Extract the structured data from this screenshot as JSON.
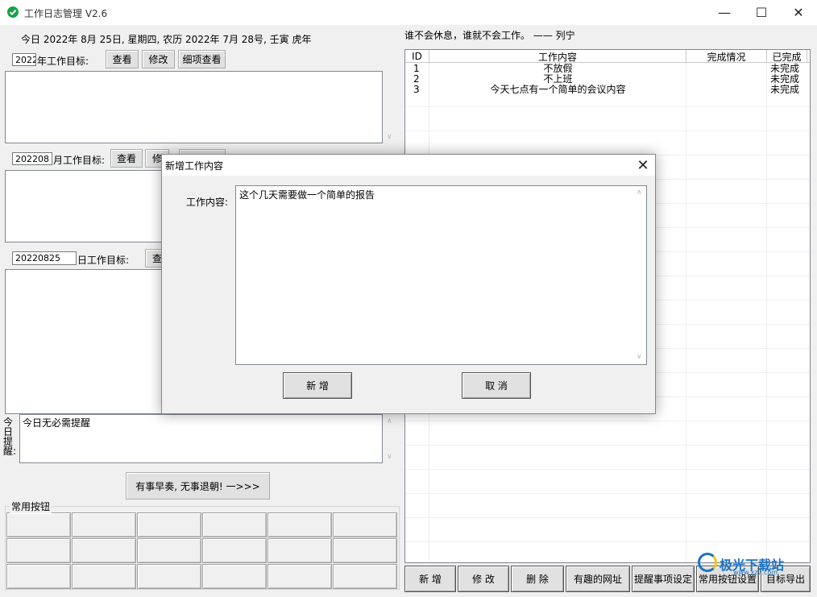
{
  "window": {
    "title": "工作日志管理 V2.6",
    "controls": {
      "minimize": "—",
      "maximize": "☐",
      "close": "✕"
    }
  },
  "header": {
    "date_line": "今日 2022年 8月 25日, 星期四, 农历 2022年 7月 28号, 壬寅 虎年",
    "quote": "谁不会休息，谁就不会工作。 —— 列宁"
  },
  "year_goal": {
    "value": "2022",
    "label": "年工作目标:",
    "view_button": "查看",
    "edit_button": "修改",
    "detail_button": "细项查看",
    "text": ""
  },
  "month_goal": {
    "value": "202208",
    "label": "月工作目标:",
    "view_button": "查看",
    "edit_button": "修",
    "text": ""
  },
  "day_goal": {
    "value": "20220825",
    "label": "日工作目标:",
    "view_button": "查",
    "text": ""
  },
  "reminder": {
    "label": "今日提醒:",
    "text": "今日无必需提醒"
  },
  "motto_button": "有事早奏, 无事退朝! 一>>>",
  "common_buttons": {
    "label": "常用按钮"
  },
  "task_table": {
    "columns": [
      "ID",
      "工作内容",
      "完成情况",
      "已完成"
    ],
    "rows": [
      {
        "id": "1",
        "content": "不放假",
        "status": "",
        "done": "未完成"
      },
      {
        "id": "2",
        "content": "不上班",
        "status": "",
        "done": "未完成"
      },
      {
        "id": "3",
        "content": "今天七点有一个简单的会议内容",
        "status": "",
        "done": "未完成"
      }
    ]
  },
  "bottom_toolbar": {
    "add": "新  增",
    "edit": "修  改",
    "delete": "删  除",
    "fun_sites": "有趣的网址",
    "reminder_settings": "提醒事项设定",
    "common_settings": "常用按钮设置",
    "export": "目标导出"
  },
  "dialog": {
    "title": "新增工作内容",
    "close": "✕",
    "content_label": "工作内容:",
    "content_value": "这个几天需要做一个简单的报告",
    "add_button": "新  增",
    "cancel_button": "取  消"
  },
  "watermark": {
    "text": "极光下载站",
    "url": "www.xz7.com"
  },
  "colors": {
    "app_icon": "#16a34a",
    "watermark": "#1a73c8"
  }
}
